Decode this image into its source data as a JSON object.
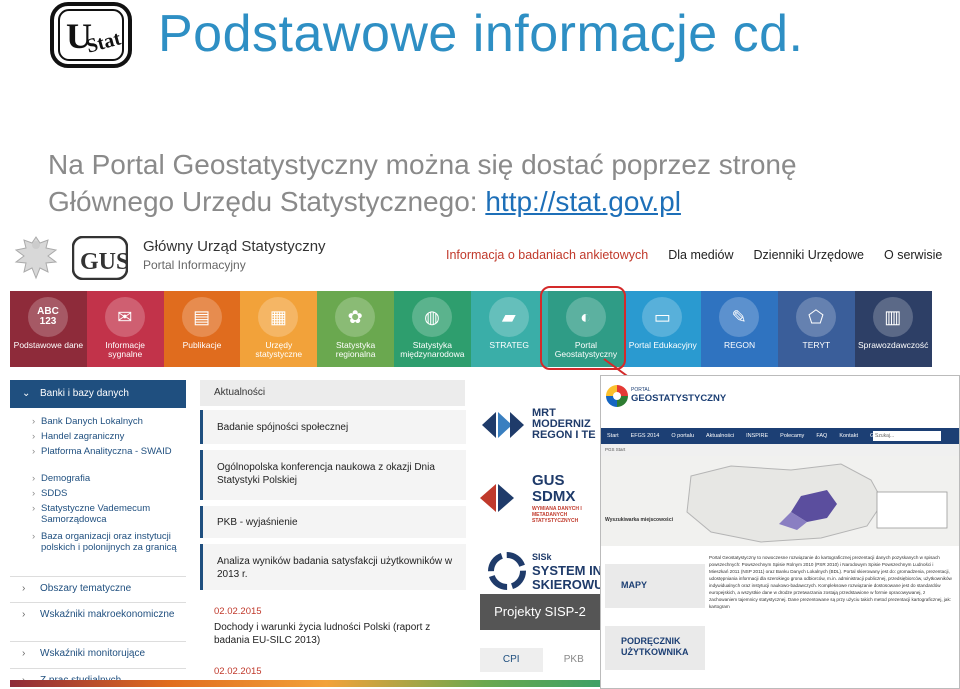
{
  "slide": {
    "title": "Podstawowe informacje cd.",
    "intro_before": "Na Portal Geostatystyczny można się dostać poprzez stronę Głównego Urzędu Statystycznego: ",
    "link_text": "http://stat.gov.pl"
  },
  "site": {
    "name": "Główny Urząd Statystyczny",
    "subtitle": "Portal Informacyjny",
    "top_nav": [
      "Informacja o badaniach ankietowych",
      "Dla mediów",
      "Dzienniki Urzędowe",
      "O serwisie"
    ],
    "tiles": [
      {
        "label": "Podstawowe dane",
        "icon": "ABC\n123",
        "color": "#8e2b3a"
      },
      {
        "label": "Informacje sygnalne",
        "icon": "chat-icon",
        "color": "#c2334a"
      },
      {
        "label": "Publikacje",
        "icon": "book-icon",
        "color": "#e06c1e"
      },
      {
        "label": "Urzędy statystyczne",
        "icon": "building-icon",
        "color": "#f2a23a"
      },
      {
        "label": "Statystyka regionalna",
        "icon": "regions-icon",
        "color": "#6aa84f"
      },
      {
        "label": "Statystyka międzynarodowa",
        "icon": "globe-icon",
        "color": "#2e9e6e"
      },
      {
        "label": "STRATEG",
        "icon": "strateg-icon",
        "color": "#3aaea8"
      },
      {
        "label": "Portal Geostatystyczny",
        "icon": "geo-icon",
        "color": "#2f9c86"
      },
      {
        "label": "Portal Edukacyjny",
        "icon": "screen-icon",
        "color": "#2a9ad0"
      },
      {
        "label": "REGON",
        "icon": "document-icon",
        "color": "#2f73c0"
      },
      {
        "label": "TERYT",
        "icon": "poland-map-icon",
        "color": "#3a5e9a"
      },
      {
        "label": "Sprawozdawczość",
        "icon": "chart-icon",
        "color": "#2d3f66"
      }
    ],
    "sidebar": {
      "header": "Banki i bazy danych",
      "items": [
        "Bank Danych Lokalnych",
        "Handel zagraniczny",
        "Platforma Analityczna - SWAID",
        "Demografia",
        "SDDS",
        "Statystyczne Vademecum Samorządowca",
        "Baza organizacji oraz instytucji polskich i polonijnych za granicą"
      ],
      "sections": [
        "Obszary tematyczne",
        "Wskaźniki makroekonomiczne",
        "Wskaźniki monitorujące",
        "Z prac studialnych"
      ]
    },
    "news": {
      "header": "Aktualności",
      "items": [
        "Badanie spójności społecznej",
        "Ogólnopolska konferencja naukowa z okazji Dnia Statystyki Polskiej",
        "PKB - wyjaśnienie",
        "Analiza wyników badania satysfakcji użytkowników w 2013 r."
      ],
      "dated": [
        {
          "date": "02.02.2015",
          "text": "Dochody i warunki życia ludności Polski (raport z badania EU-SILC 2013)"
        },
        {
          "date": "02.02.2015",
          "text": ""
        }
      ]
    },
    "banners": {
      "mrt": "MRT MODERNIZ REGON I TE",
      "sdmx_1": "GUS",
      "sdmx_2": "SDMX",
      "sdmx_3": "WYMIANA DANYCH I METADANYCH STATYSTYCZNYCH",
      "sisk_1": "SISk",
      "sisk_2": "SYSTEM INF",
      "sisk_3": "SKIEROWU",
      "projekty": "Projekty SISP-2",
      "tabs": [
        "CPI",
        "PKB"
      ]
    }
  },
  "geoportal": {
    "logo_small": "PORTAL",
    "logo_title": "GEOSTATYSTYCZNY",
    "nav": [
      "Start",
      "EFGS 2014",
      "O portalu",
      "Aktualności",
      "INSPIRE",
      "Polecamy",
      "FAQ",
      "Kontakt",
      "GRA"
    ],
    "search_placeholder": "Szukaj...",
    "breadcrumb": "PGS   Start",
    "map_search": "Wyszukiwarka miejscowości",
    "buttons": [
      "MAPY",
      "PODRĘCZNIK UŻYTKOWNIKA"
    ],
    "text": "Portal Geostatystyczny to nowoczesne rozwiązanie do kartograficznej prezentacji danych pozyskanych w spisach powszechnych: Powszechnym Spisie Rolnym 2010 (PSR 2010) i Narodowym Spisie Powszechnym Ludności i Mieszkań 2011 (NSP 2011) oraz Banku Danych Lokalnych (BDL). Portal skierowany jest do: gromadzenia, prezentacji, udostępniania informacji dla szerokiego grona odbiorców, m.in. administracji publicznej, przedsiębiorców, użytkowników indywidualnych oraz instytucji naukowo-badawczych. Kompleksowe rozwiązanie dostosowane jest do standardów europejskich, a wszystkie dane w drodze przetwarzania zostają przedstawione w formie opracowywanej, z zachowaniem tajemnicy statystycznej. Dane prezentowane są przy użyciu takich metod prezentacji kartograficznej, jak: kartogram"
  }
}
